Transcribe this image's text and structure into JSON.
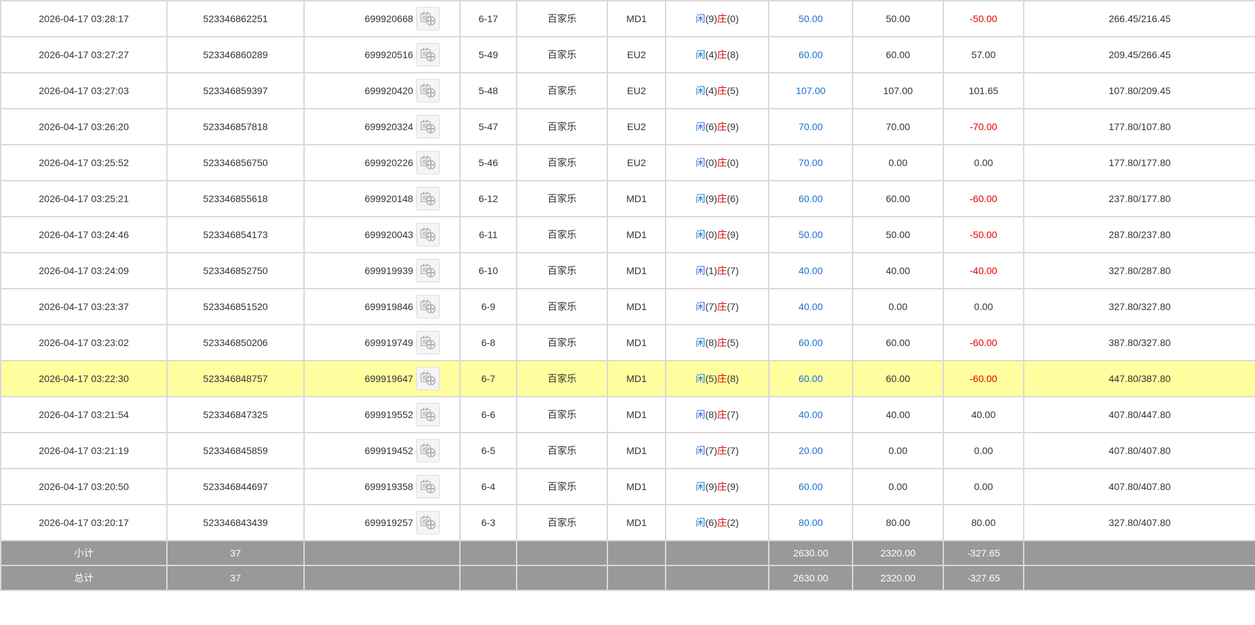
{
  "colors": {
    "highlight": "#ffffa0",
    "blue": "#1c6fd6",
    "red": "#e60000",
    "summary_bg": "#999999"
  },
  "rows": [
    {
      "time": "2026-04-17 03:28:17",
      "order": "523346862251",
      "game": "699920668",
      "table": "6-17",
      "type": "百家乐",
      "room": "MD1",
      "player": "闲",
      "pv": "(9)",
      "banker": "庄",
      "bv": "(0)",
      "bet": "50.00",
      "valid": "50.00",
      "win": "-50.00",
      "win_red": true,
      "balance": "266.45/216.45",
      "hl": false
    },
    {
      "time": "2026-04-17 03:27:27",
      "order": "523346860289",
      "game": "699920516",
      "table": "5-49",
      "type": "百家乐",
      "room": "EU2",
      "player": "闲",
      "pv": "(4)",
      "banker": "庄",
      "bv": "(8)",
      "bet": "60.00",
      "valid": "60.00",
      "win": "57.00",
      "win_red": false,
      "balance": "209.45/266.45",
      "hl": false
    },
    {
      "time": "2026-04-17 03:27:03",
      "order": "523346859397",
      "game": "699920420",
      "table": "5-48",
      "type": "百家乐",
      "room": "EU2",
      "player": "闲",
      "pv": "(4)",
      "banker": "庄",
      "bv": "(5)",
      "bet": "107.00",
      "valid": "107.00",
      "win": "101.65",
      "win_red": false,
      "balance": "107.80/209.45",
      "hl": false
    },
    {
      "time": "2026-04-17 03:26:20",
      "order": "523346857818",
      "game": "699920324",
      "table": "5-47",
      "type": "百家乐",
      "room": "EU2",
      "player": "闲",
      "pv": "(6)",
      "banker": "庄",
      "bv": "(9)",
      "bet": "70.00",
      "valid": "70.00",
      "win": "-70.00",
      "win_red": true,
      "balance": "177.80/107.80",
      "hl": false
    },
    {
      "time": "2026-04-17 03:25:52",
      "order": "523346856750",
      "game": "699920226",
      "table": "5-46",
      "type": "百家乐",
      "room": "EU2",
      "player": "闲",
      "pv": "(0)",
      "banker": "庄",
      "bv": "(0)",
      "bet": "70.00",
      "valid": "0.00",
      "win": "0.00",
      "win_red": false,
      "balance": "177.80/177.80",
      "hl": false
    },
    {
      "time": "2026-04-17 03:25:21",
      "order": "523346855618",
      "game": "699920148",
      "table": "6-12",
      "type": "百家乐",
      "room": "MD1",
      "player": "闲",
      "pv": "(9)",
      "banker": "庄",
      "bv": "(6)",
      "bet": "60.00",
      "valid": "60.00",
      "win": "-60.00",
      "win_red": true,
      "balance": "237.80/177.80",
      "hl": false
    },
    {
      "time": "2026-04-17 03:24:46",
      "order": "523346854173",
      "game": "699920043",
      "table": "6-11",
      "type": "百家乐",
      "room": "MD1",
      "player": "闲",
      "pv": "(0)",
      "banker": "庄",
      "bv": "(9)",
      "bet": "50.00",
      "valid": "50.00",
      "win": "-50.00",
      "win_red": true,
      "balance": "287.80/237.80",
      "hl": false
    },
    {
      "time": "2026-04-17 03:24:09",
      "order": "523346852750",
      "game": "699919939",
      "table": "6-10",
      "type": "百家乐",
      "room": "MD1",
      "player": "闲",
      "pv": "(1)",
      "banker": "庄",
      "bv": "(7)",
      "bet": "40.00",
      "valid": "40.00",
      "win": "-40.00",
      "win_red": true,
      "balance": "327.80/287.80",
      "hl": false
    },
    {
      "time": "2026-04-17 03:23:37",
      "order": "523346851520",
      "game": "699919846",
      "table": "6-9",
      "type": "百家乐",
      "room": "MD1",
      "player": "闲",
      "pv": "(7)",
      "banker": "庄",
      "bv": "(7)",
      "bet": "40.00",
      "valid": "0.00",
      "win": "0.00",
      "win_red": false,
      "balance": "327.80/327.80",
      "hl": false
    },
    {
      "time": "2026-04-17 03:23:02",
      "order": "523346850206",
      "game": "699919749",
      "table": "6-8",
      "type": "百家乐",
      "room": "MD1",
      "player": "闲",
      "pv": "(8)",
      "banker": "庄",
      "bv": "(5)",
      "bet": "60.00",
      "valid": "60.00",
      "win": "-60.00",
      "win_red": true,
      "balance": "387.80/327.80",
      "hl": false
    },
    {
      "time": "2026-04-17 03:22:30",
      "order": "523346848757",
      "game": "699919647",
      "table": "6-7",
      "type": "百家乐",
      "room": "MD1",
      "player": "闲",
      "pv": "(5)",
      "banker": "庄",
      "bv": "(8)",
      "bet": "60.00",
      "valid": "60.00",
      "win": "-60.00",
      "win_red": true,
      "balance": "447.80/387.80",
      "hl": true
    },
    {
      "time": "2026-04-17 03:21:54",
      "order": "523346847325",
      "game": "699919552",
      "table": "6-6",
      "type": "百家乐",
      "room": "MD1",
      "player": "闲",
      "pv": "(8)",
      "banker": "庄",
      "bv": "(7)",
      "bet": "40.00",
      "valid": "40.00",
      "win": "40.00",
      "win_red": false,
      "balance": "407.80/447.80",
      "hl": false
    },
    {
      "time": "2026-04-17 03:21:19",
      "order": "523346845859",
      "game": "699919452",
      "table": "6-5",
      "type": "百家乐",
      "room": "MD1",
      "player": "闲",
      "pv": "(7)",
      "banker": "庄",
      "bv": "(7)",
      "bet": "20.00",
      "valid": "0.00",
      "win": "0.00",
      "win_red": false,
      "balance": "407.80/407.80",
      "hl": false
    },
    {
      "time": "2026-04-17 03:20:50",
      "order": "523346844697",
      "game": "699919358",
      "table": "6-4",
      "type": "百家乐",
      "room": "MD1",
      "player": "闲",
      "pv": "(9)",
      "banker": "庄",
      "bv": "(9)",
      "bet": "60.00",
      "valid": "0.00",
      "win": "0.00",
      "win_red": false,
      "balance": "407.80/407.80",
      "hl": false
    },
    {
      "time": "2026-04-17 03:20:17",
      "order": "523346843439",
      "game": "699919257",
      "table": "6-3",
      "type": "百家乐",
      "room": "MD1",
      "player": "闲",
      "pv": "(6)",
      "banker": "庄",
      "bv": "(2)",
      "bet": "80.00",
      "valid": "80.00",
      "win": "80.00",
      "win_red": false,
      "balance": "327.80/407.80",
      "hl": false
    }
  ],
  "summary": [
    {
      "label": "小计",
      "count": "37",
      "bet": "2630.00",
      "valid": "2320.00",
      "win": "-327.65"
    },
    {
      "label": "总计",
      "count": "37",
      "bet": "2630.00",
      "valid": "2320.00",
      "win": "-327.65"
    }
  ]
}
